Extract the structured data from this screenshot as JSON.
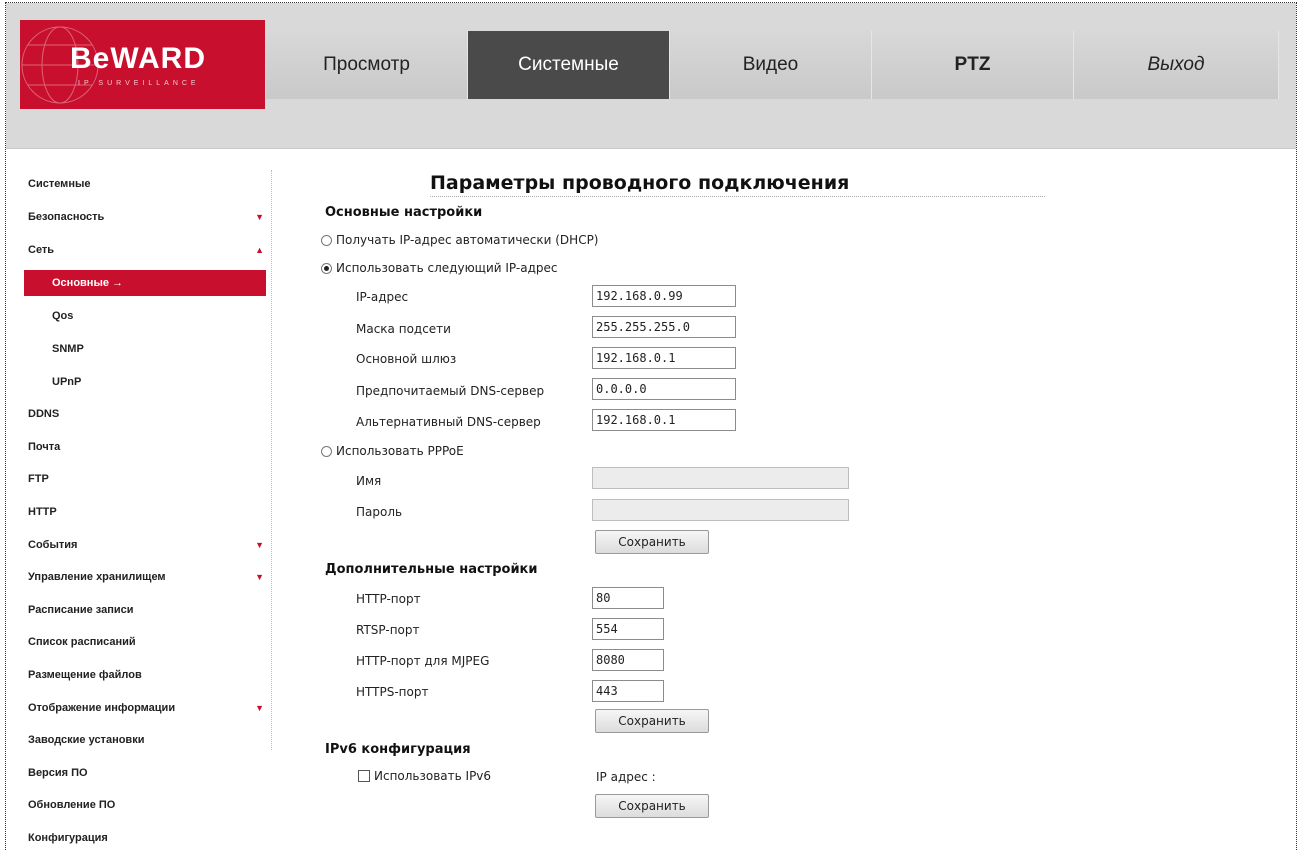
{
  "brand": {
    "name": "BeWARD",
    "tagline": "IP SURVEILLANCE",
    "color": "#c8102e"
  },
  "nav": {
    "items": [
      {
        "label": "Просмотр"
      },
      {
        "label": "Системные"
      },
      {
        "label": "Видео"
      },
      {
        "label": "PTZ"
      },
      {
        "label": "Выход"
      }
    ],
    "active": "Системные"
  },
  "sidebar": {
    "items": [
      {
        "label": "Системные"
      },
      {
        "label": "Безопасность",
        "arrow": "▼"
      },
      {
        "label": "Сеть",
        "arrow": "▲"
      },
      {
        "label": "Основные →"
      },
      {
        "label": "Qos"
      },
      {
        "label": "SNMP"
      },
      {
        "label": "UPnP"
      },
      {
        "label": "DDNS"
      },
      {
        "label": "Почта"
      },
      {
        "label": "FTP"
      },
      {
        "label": "HTTP"
      },
      {
        "label": "События",
        "arrow": "▼"
      },
      {
        "label": "Управление хранилищем",
        "arrow": "▼"
      },
      {
        "label": "Расписание записи"
      },
      {
        "label": "Список расписаний"
      },
      {
        "label": "Размещение файлов"
      },
      {
        "label": "Отображение информации",
        "arrow": "▼"
      },
      {
        "label": "Заводские установки"
      },
      {
        "label": "Версия ПО"
      },
      {
        "label": "Обновление ПО"
      },
      {
        "label": "Конфигурация"
      }
    ]
  },
  "main": {
    "title": "Параметры проводного подключения",
    "basic": {
      "heading": "Основные настройки",
      "dhcp_label": "Получать IP-адрес автоматически (DHCP)",
      "static_label": "Использовать следующий IP-адрес",
      "fields": [
        {
          "label": "IP-адрес",
          "value": "192.168.0.99"
        },
        {
          "label": "Маска подсети",
          "value": "255.255.255.0"
        },
        {
          "label": "Основной шлюз",
          "value": "192.168.0.1"
        },
        {
          "label": "Предпочитаемый DNS-сервер",
          "value": "0.0.0.0"
        },
        {
          "label": "Альтернативный DNS-сервер",
          "value": "192.168.0.1"
        }
      ],
      "pppoe_label": "Использовать PPPoE",
      "pppoe_name_label": "Имя",
      "pppoe_name_value": "",
      "pppoe_password_label": "Пароль",
      "pppoe_password_value": "",
      "save_label": "Сохранить"
    },
    "advanced": {
      "heading": "Дополнительные настройки",
      "fields": [
        {
          "label": "HTTP-порт",
          "value": "80"
        },
        {
          "label": "RTSP-порт",
          "value": "554"
        },
        {
          "label": "HTTP-порт для MJPEG",
          "value": "8080"
        },
        {
          "label": "HTTPS-порт",
          "value": "443"
        }
      ],
      "save_label": "Сохранить"
    },
    "ipv6": {
      "heading": "IPv6 конфигурация",
      "checkbox_label": "Использовать IPv6",
      "ip_label": "IP адрес :",
      "save_label": "Сохранить"
    }
  }
}
